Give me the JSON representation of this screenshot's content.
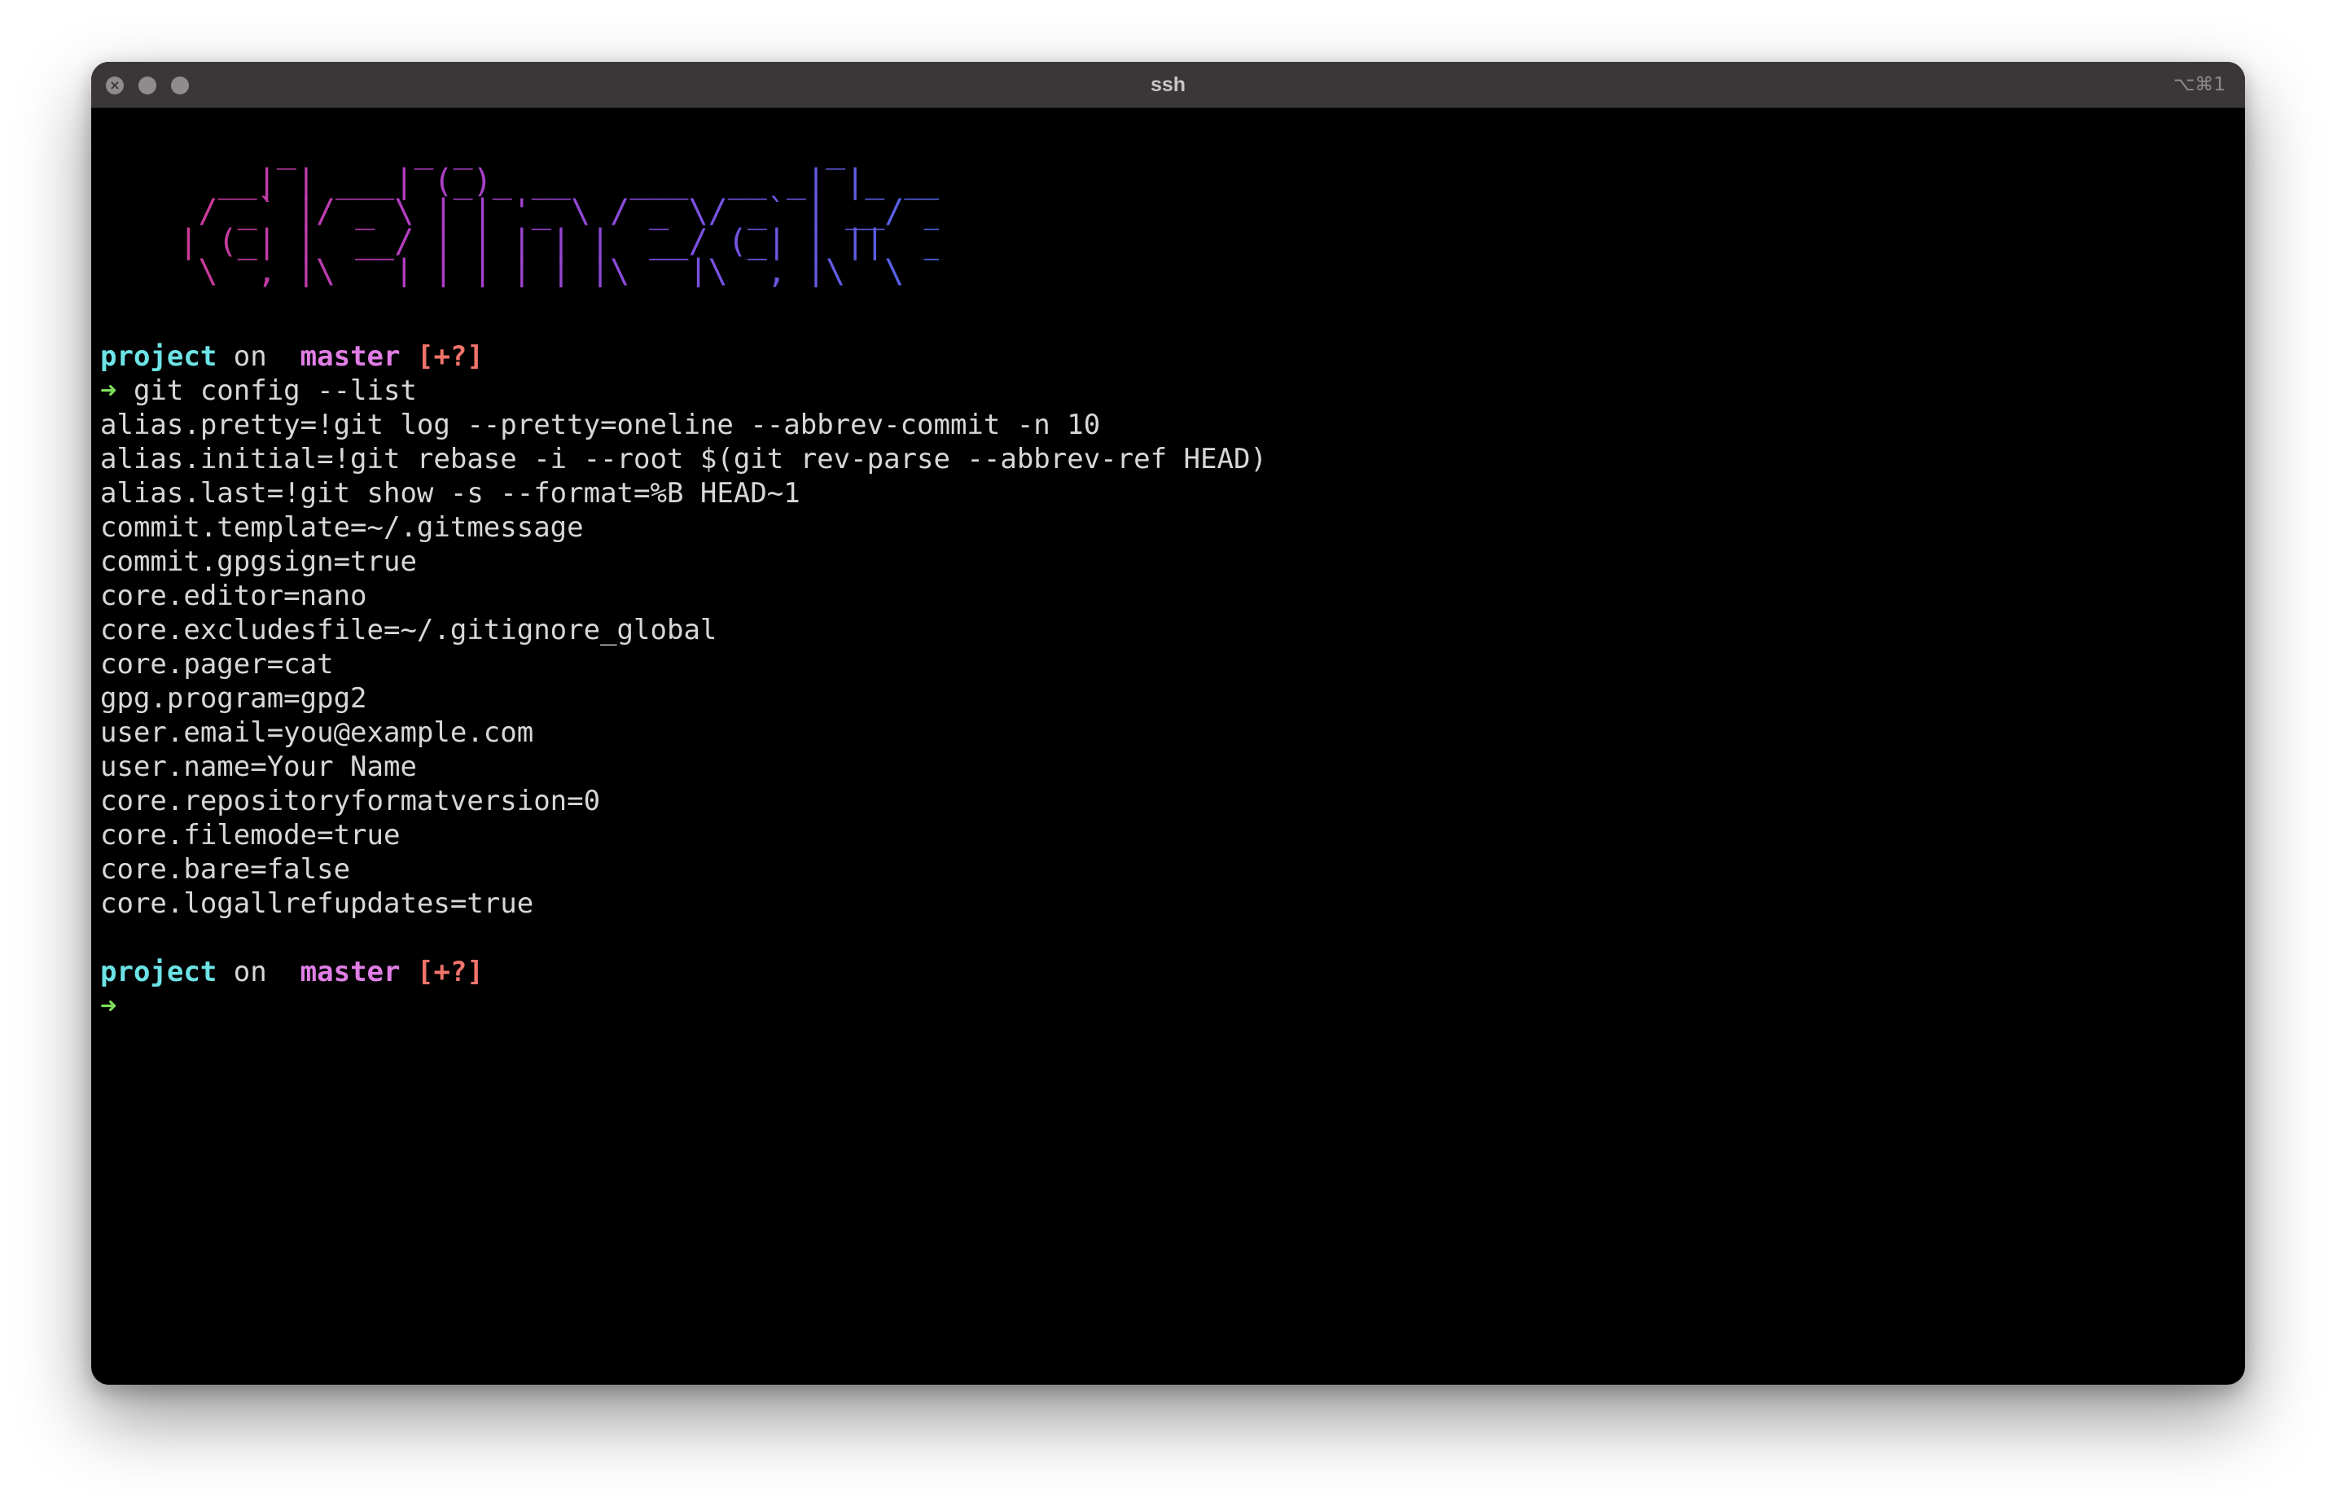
{
  "window": {
    "title": "ssh",
    "shortcut": "⌥⌘1"
  },
  "banner": {
    "art": "         _      _ _                  _        _       \n      __| | ___| (_)_ __   ___  __ _| |_ ___ (_) ___  \n     / _` |/ _ \\ | | '_ \\ / _ \\/ _` | __/ _ \\| |/ _ \\ \n    | (_| |  __/ | | | | |  __/ (_| | ||  __/| | (_) |\n     \\__,_|\\___|_|_|_| |_|\\___|\\__,_|\\__\\___(_)_|\\___/ ",
    "colors": [
      "#d23a86",
      "#b03ec6",
      "#7d4fe0",
      "#5164e6"
    ]
  },
  "prompt1": {
    "dir": "project",
    "on": " on ",
    "branch_icon": "",
    "branch": "master",
    "status": "[+?]",
    "arrow": "➜",
    "command": " git config --list"
  },
  "output": [
    "alias.pretty=!git log --pretty=oneline --abbrev-commit -n 10",
    "alias.initial=!git rebase -i --root $(git rev-parse --abbrev-ref HEAD)",
    "alias.last=!git show -s --format=%B HEAD~1",
    "commit.template=~/.gitmessage",
    "commit.gpgsign=true",
    "core.editor=nano",
    "core.excludesfile=~/.gitignore_global",
    "core.pager=cat",
    "gpg.program=gpg2",
    "user.email=you@example.com",
    "user.name=Your Name",
    "core.repositoryformatversion=0",
    "core.filemode=true",
    "core.bare=false",
    "core.logallrefupdates=true"
  ],
  "prompt2": {
    "dir": "project",
    "on": " on ",
    "branch_icon": "",
    "branch": "master",
    "status": "[+?]",
    "arrow": "➜",
    "command": ""
  },
  "colors": {
    "dir": "#6de3e6",
    "branch": "#e07ee6",
    "status": "#f0746b",
    "arrow": "#7ee05a",
    "text": "#d7d7d7",
    "background": "#000000",
    "titlebar": "#3b3739"
  }
}
